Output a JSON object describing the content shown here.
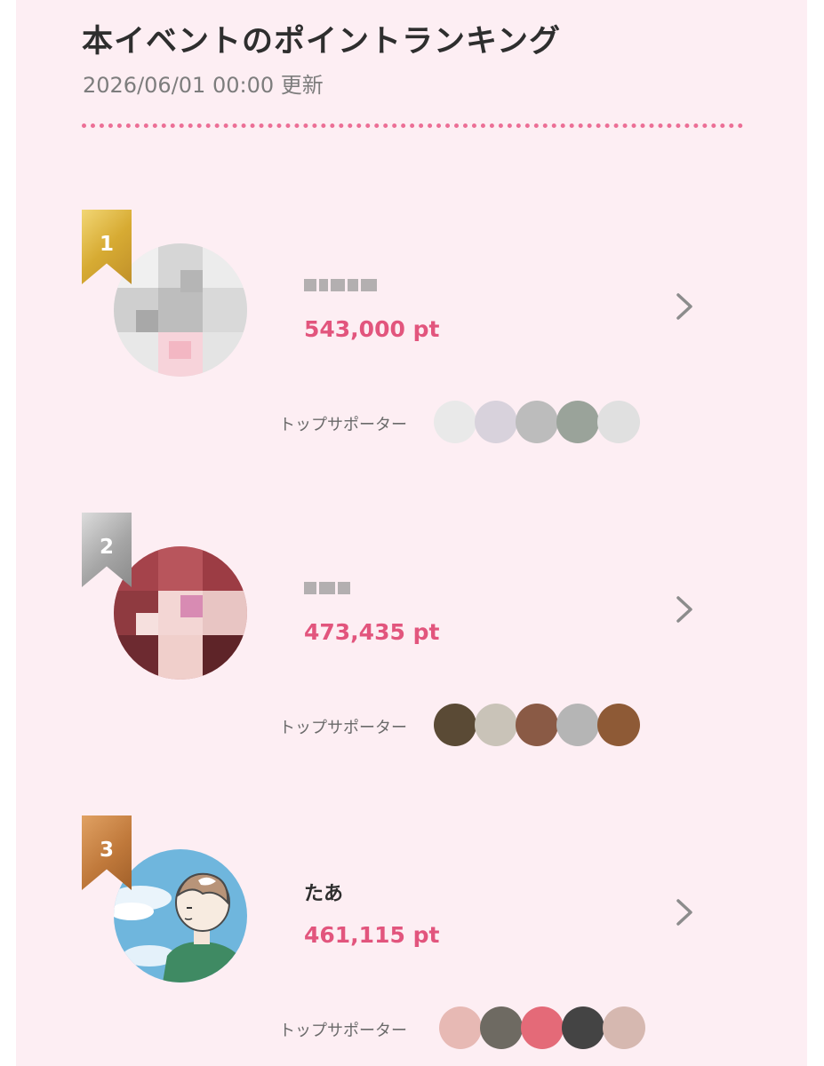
{
  "header": {
    "title": "本イベントのポイントランキング",
    "updated": "2026/06/01 00:00 更新"
  },
  "supporter_label": "トップサポーター",
  "entries": [
    {
      "rank": "1",
      "name": "",
      "points": "543,000 pt",
      "name_redacted": true
    },
    {
      "rank": "2",
      "name": "",
      "points": "473,435 pt",
      "name_redacted": true
    },
    {
      "rank": "3",
      "name": "たあ",
      "points": "461,115 pt",
      "name_redacted": false
    }
  ],
  "colors": {
    "background": "#fdeef3",
    "accent": "#e2557d",
    "divider": "#ec6f96",
    "gold": "#d7ab33",
    "silver": "#a6a6a6",
    "bronze": "#c0793b"
  },
  "icons": [
    "chevron-right-icon",
    "rank-ribbon-icon"
  ]
}
